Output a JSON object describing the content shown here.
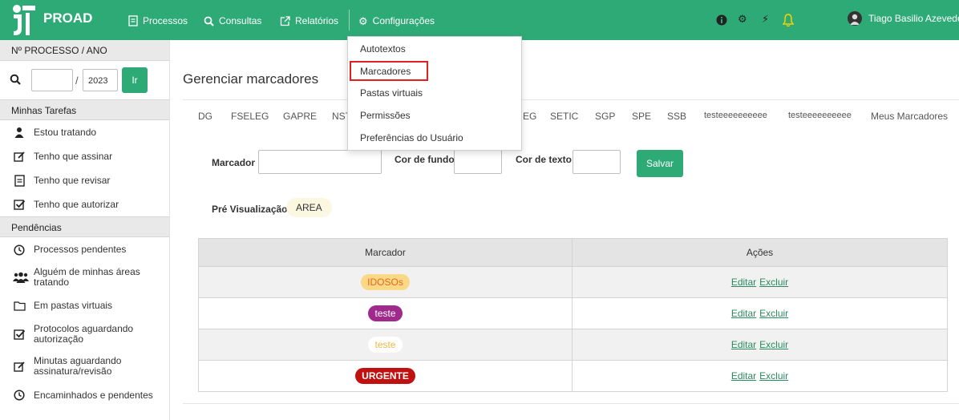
{
  "app": {
    "brand": "PROAD",
    "user_name": "Tiago Basilio Azevedo"
  },
  "nav": {
    "processos": "Processos",
    "consultas": "Consultas",
    "relatorios": "Relatórios",
    "configuracoes": "Configurações"
  },
  "config_menu": {
    "items": [
      "Autotextos",
      "Marcadores",
      "Pastas virtuais",
      "Permissões",
      "Preferências do Usuário"
    ],
    "highlighted": "Marcadores"
  },
  "sidebar": {
    "search_header": "Nº PROCESSO / ANO",
    "search_year": "2023",
    "search_sep": "/",
    "go_label": "Ir",
    "section_tasks": "Minhas Tarefas",
    "tasks": [
      "Estou tratando",
      "Tenho que assinar",
      "Tenho que revisar",
      "Tenho que autorizar"
    ],
    "section_pending": "Pendências",
    "pending": [
      [
        "Processos pendentes"
      ],
      [
        "Alguém de minhas áreas",
        "tratando"
      ],
      [
        "Em pastas virtuais"
      ],
      [
        "Protocolos aguardando",
        "autorização"
      ],
      [
        "Minutas aguardando",
        "assinatura/revisão"
      ],
      [
        "Encaminhados e pendentes"
      ]
    ]
  },
  "page": {
    "title": "Gerenciar marcadores"
  },
  "tabs": [
    "DG",
    "FSELEG",
    "GAPRE",
    "NST",
    "EG",
    "SETIC",
    "SGP",
    "SPE",
    "SSB",
    "testeeeeeeeeee",
    "testeeeeeeeeee",
    "Meus Marcadores"
  ],
  "form": {
    "marcador_label": "Marcador",
    "cor_fundo_label": "Cor de fundo",
    "cor_texto_label": "Cor de texto",
    "save_label": "Salvar",
    "preview_label": "Pré Visualização",
    "preview_value": "AREA"
  },
  "table": {
    "headers": [
      "Marcador",
      "Ações"
    ],
    "rows": [
      {
        "label": "IDOSOs",
        "bg": "#fbd886",
        "fg": "#e0681f"
      },
      {
        "label": "teste",
        "bg": "#a02a8c",
        "fg": "#ffffff"
      },
      {
        "label": "teste",
        "bg": "#ffffff",
        "fg": "#f0b84a"
      },
      {
        "label": "URGENTE",
        "bg": "#c01010",
        "fg": "#ffffff"
      }
    ],
    "edit_label": "Editar",
    "delete_label": "Excluir"
  },
  "colors": {
    "brand": "#2eaa77",
    "highlight": "#e02020"
  }
}
